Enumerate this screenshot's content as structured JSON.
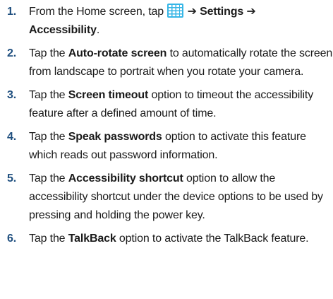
{
  "steps": [
    {
      "number": "1.",
      "parts": {
        "a": "From the Home screen, tap ",
        "arrow1": "➔",
        "b": "Settings",
        "arrow2": "➔",
        "c": "Accessibility",
        "d": "."
      },
      "icon": "apps-grid-icon"
    },
    {
      "number": "2.",
      "parts": {
        "a": "Tap the ",
        "b": "Auto-rotate screen",
        "c": " to automatically rotate the screen from landscape to portrait when you rotate your camera."
      }
    },
    {
      "number": "3.",
      "parts": {
        "a": "Tap the ",
        "b": "Screen timeout",
        "c": " option to timeout the accessibility feature after a defined amount of time."
      }
    },
    {
      "number": "4.",
      "parts": {
        "a": "Tap the ",
        "b": "Speak passwords",
        "c": " option to activate this feature which reads out password information."
      }
    },
    {
      "number": "5.",
      "parts": {
        "a": "Tap the ",
        "b": "Accessibility shortcut",
        "c": " option to allow the accessibility shortcut under the device options to be used by pressing and holding the power key."
      }
    },
    {
      "number": "6.",
      "parts": {
        "a": "Tap the ",
        "b": "TalkBack",
        "c": " option to activate the TalkBack feature."
      }
    }
  ],
  "colors": {
    "number": "#1f4f7f",
    "icon_fill": "#36b6e6",
    "icon_grid": "#ffffff"
  }
}
